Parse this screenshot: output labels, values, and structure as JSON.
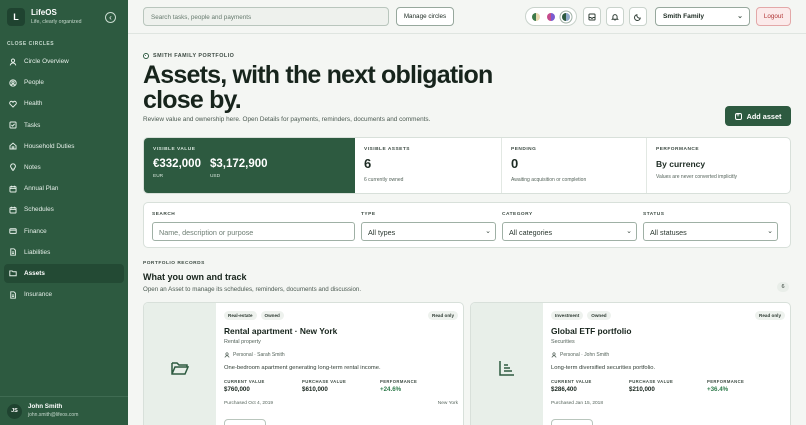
{
  "app": {
    "badge": "L",
    "name": "LifeOS",
    "tagline": "Life, clearly organized"
  },
  "sidebar": {
    "section_label": "CLOSE CIRCLES",
    "items": [
      {
        "label": "Circle Overview",
        "icon": "user-icon"
      },
      {
        "label": "People",
        "icon": "people-icon"
      },
      {
        "label": "Health",
        "icon": "heart-icon"
      },
      {
        "label": "Tasks",
        "icon": "checkbox-icon"
      },
      {
        "label": "Household Duties",
        "icon": "home-icon"
      },
      {
        "label": "Notes",
        "icon": "lightbulb-icon"
      },
      {
        "label": "Annual Plan",
        "icon": "calendar-icon"
      },
      {
        "label": "Schedules",
        "icon": "calendar-icon"
      },
      {
        "label": "Finance",
        "icon": "wallet-icon"
      },
      {
        "label": "Liabilities",
        "icon": "document-icon"
      },
      {
        "label": "Assets",
        "icon": "folder-icon",
        "active": true
      },
      {
        "label": "Insurance",
        "icon": "document-icon"
      }
    ]
  },
  "user": {
    "initials": "JS",
    "name": "John Smith",
    "email": "john.smith@lifeos.com"
  },
  "topbar": {
    "search_placeholder": "Search tasks, people and payments",
    "manage_circles": "Manage circles",
    "family": "Smith Family",
    "logout": "Logout"
  },
  "hero": {
    "eyebrow": "SMITH FAMILY PORTFOLIO",
    "title": "Assets, with the next obligation close by.",
    "subtitle": "Review value and ownership here. Open Details for payments, reminders, documents and comments.",
    "add_button": "Add asset"
  },
  "stats": {
    "visible_value": {
      "label": "VISIBLE VALUE",
      "amounts": [
        {
          "value": "€332,000",
          "currency": "EUR"
        },
        {
          "value": "$3,172,900",
          "currency": "USD"
        }
      ]
    },
    "visible_assets": {
      "label": "VISIBLE ASSETS",
      "value": "6",
      "note": "6 currently owned"
    },
    "pending": {
      "label": "PENDING",
      "value": "0",
      "note": "Awaiting acquisition or completion"
    },
    "performance": {
      "label": "PERFORMANCE",
      "value": "By currency",
      "note": "Values are never converted implicitly"
    }
  },
  "filters": {
    "search_label": "SEARCH",
    "search_placeholder": "Name, description or purpose",
    "type_label": "TYPE",
    "type_value": "All types",
    "category_label": "CATEGORY",
    "category_value": "All categories",
    "status_label": "STATUS",
    "status_value": "All statuses"
  },
  "records": {
    "label": "PORTFOLIO RECORDS",
    "title": "What you own and track",
    "subtitle": "Open an Asset to manage its schedules, reminders, documents and discussion.",
    "count": "6"
  },
  "cards": [
    {
      "pills": [
        "Real-estate",
        "Owned"
      ],
      "badge": "Read only",
      "title": "Rental apartment · New York",
      "subtype": "Rental property",
      "owner": "Personal · Sarah Smith",
      "description": "One-bedroom apartment generating long-term rental income.",
      "metrics": [
        {
          "label": "CURRENT VALUE",
          "value": "$760,000"
        },
        {
          "label": "PURCHASE VALUE",
          "value": "$610,000"
        },
        {
          "label": "PERFORMANCE",
          "value": "+24.6%"
        }
      ],
      "purchased": "Purchased Oct 4, 2019",
      "location": "New York"
    },
    {
      "pills": [
        "Investment",
        "Owned"
      ],
      "badge": "Read only",
      "title": "Global ETF portfolio",
      "subtype": "Securities",
      "owner": "Personal · John Smith",
      "description": "Long-term diversified securities portfolio.",
      "metrics": [
        {
          "label": "CURRENT VALUE",
          "value": "$286,400"
        },
        {
          "label": "PURCHASE VALUE",
          "value": "$210,000"
        },
        {
          "label": "PERFORMANCE",
          "value": "+36.4%"
        }
      ],
      "purchased": "Purchased Jan 15, 2018",
      "location": ""
    }
  ],
  "colors": {
    "brand": "#2d5a40",
    "positive": "#2d7a4a",
    "danger": "#b03434"
  }
}
